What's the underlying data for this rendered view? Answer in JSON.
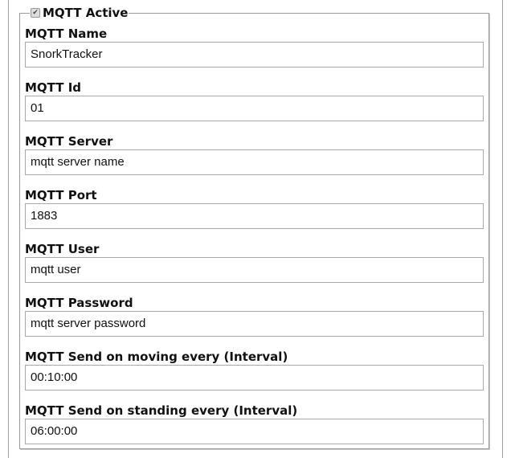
{
  "fieldset": {
    "legend": "MQTT Active",
    "active_checked": true,
    "fields": [
      {
        "label": "MQTT Name",
        "value": "SnorkTracker"
      },
      {
        "label": "MQTT Id",
        "value": "01"
      },
      {
        "label": "MQTT Server",
        "value": "mqtt server name"
      },
      {
        "label": "MQTT Port",
        "value": "1883"
      },
      {
        "label": "MQTT User",
        "value": "mqtt user"
      },
      {
        "label": "MQTT Password",
        "value": "mqtt server password"
      },
      {
        "label": "MQTT Send on moving every (Interval)",
        "value": "00:10:00"
      },
      {
        "label": "MQTT Send on standing every (Interval)",
        "value": "06:00:00"
      }
    ]
  }
}
